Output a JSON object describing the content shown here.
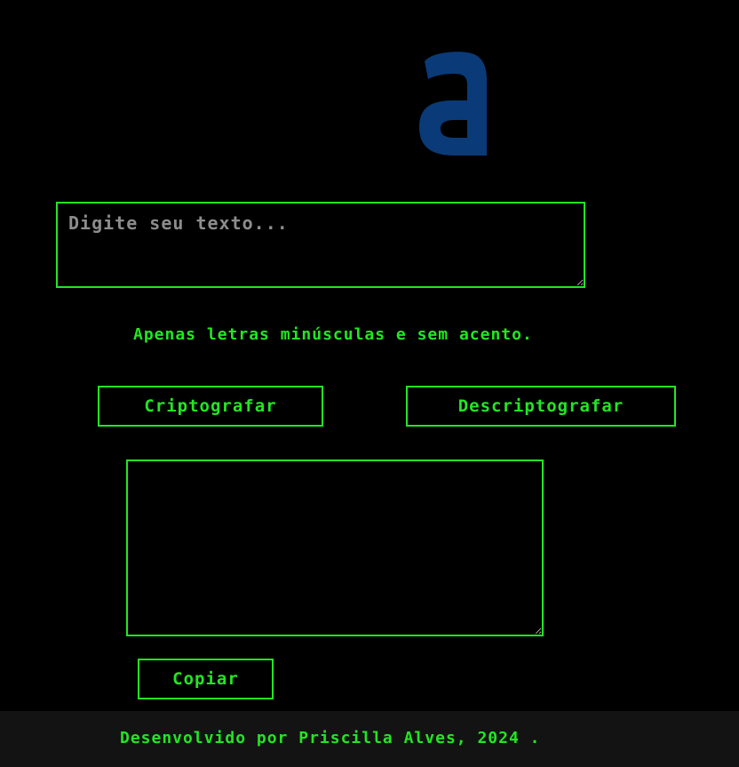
{
  "logo": {
    "letter": "a",
    "icon": "alura-logo-icon",
    "color": "#0a3a78"
  },
  "input": {
    "placeholder": "Digite seu texto...",
    "value": ""
  },
  "hint": {
    "text": "Apenas letras minúsculas e sem acento."
  },
  "buttons": {
    "encrypt_label": "Criptografar",
    "decrypt_label": "Descriptografar",
    "copy_label": "Copiar"
  },
  "output": {
    "value": ""
  },
  "footer": {
    "text": "Desenvolvido por Priscilla Alves, 2024 ."
  },
  "colors": {
    "accent": "#22e622",
    "background": "#000000",
    "footer_bg": "#131313",
    "placeholder": "#8c8c8c"
  }
}
